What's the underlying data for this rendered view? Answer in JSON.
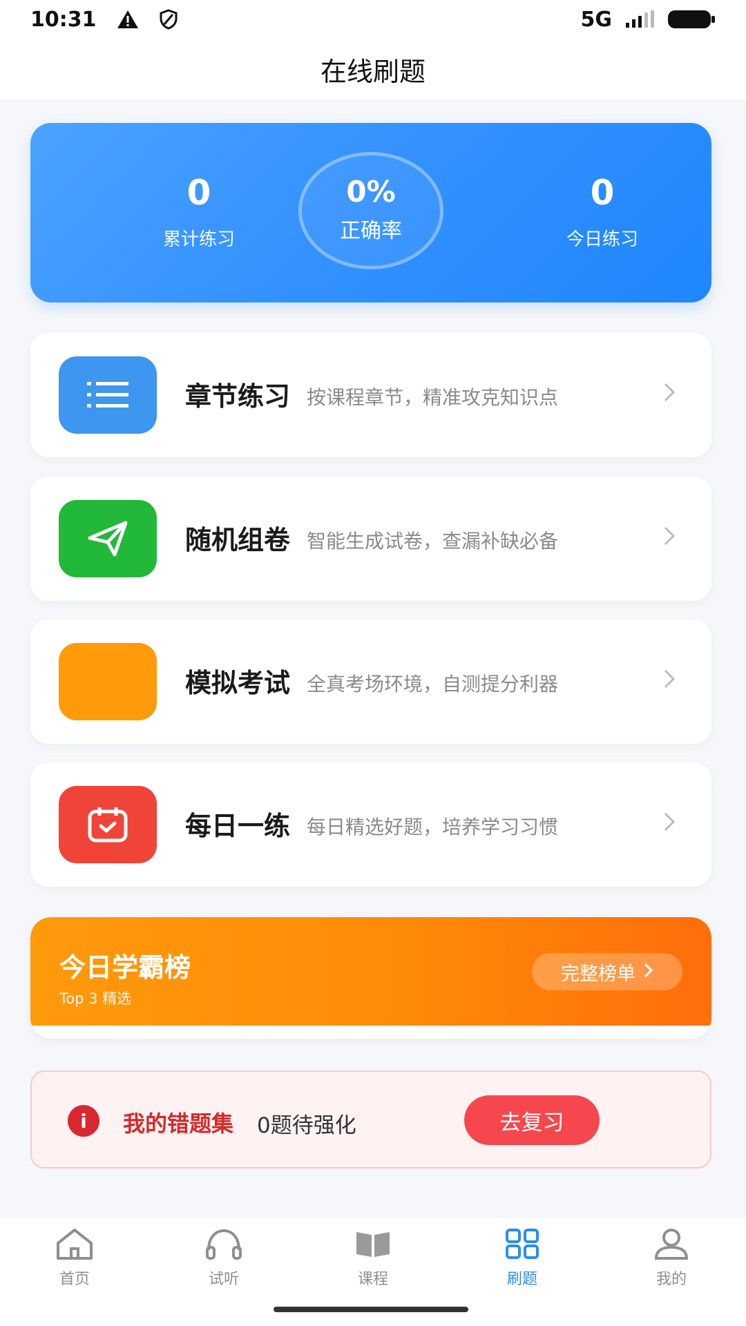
{
  "status_bar": {
    "time": "10:31",
    "network": "5G"
  },
  "header": {
    "title": "在线刷题"
  },
  "stats": {
    "total_value": "0",
    "total_label": "累计练习",
    "accuracy_value": "0%",
    "accuracy_label": "正确率",
    "today_value": "0",
    "today_label": "今日练习"
  },
  "practice": [
    {
      "title": "章节练习",
      "desc": "按课程章节，精准攻克知识点",
      "icon": "list-icon",
      "color": "#3d96ef"
    },
    {
      "title": "随机组卷",
      "desc": "智能生成试卷，查漏补缺必备",
      "icon": "paper-plane-icon",
      "color": "#22b83a"
    },
    {
      "title": "模拟考试",
      "desc": "全真考场环境，自测提分利器",
      "icon": "blank-icon",
      "color": "#ff9a0a"
    },
    {
      "title": "每日一练",
      "desc": "每日精选好题，培养学习习惯",
      "icon": "calendar-check-icon",
      "color": "#f04438"
    }
  ],
  "rank": {
    "title": "今日学霸榜",
    "subtitle": "Top 3 精选",
    "button": "完整榜单"
  },
  "wrong": {
    "title": "我的错题集",
    "count_text": "0题待强化",
    "button": "去复习"
  },
  "nav": [
    {
      "label": "首页",
      "icon": "home-icon"
    },
    {
      "label": "试听",
      "icon": "headphones-icon"
    },
    {
      "label": "课程",
      "icon": "book-icon"
    },
    {
      "label": "刷题",
      "icon": "grid-icon",
      "active": true
    },
    {
      "label": "我的",
      "icon": "user-icon"
    }
  ],
  "colors": {
    "accent": "#2c8cf0",
    "danger": "#f5474d",
    "warning": "#ff8a08"
  }
}
